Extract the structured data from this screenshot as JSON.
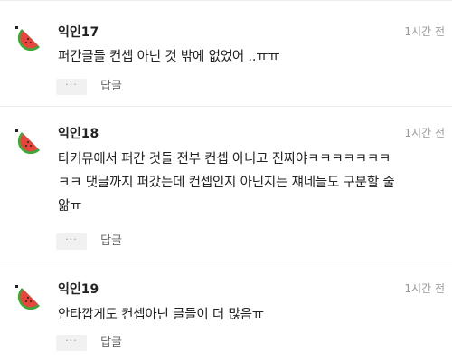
{
  "comments": [
    {
      "nickname": "익인17",
      "time": "1시간 전",
      "lines": [
        "퍼간글들 컨셉 아닌 것 밖에 없었어 ..ㅠㅠ"
      ],
      "more_label": "···",
      "reply_label": "답글"
    },
    {
      "nickname": "익인18",
      "time": "1시간 전",
      "lines": [
        "타커뮤에서 퍼간 것들 전부 컨셉 아니고 진짜야ㅋㅋㅋㅋㅋㅋㅋ",
        "ㅋㅋ 댓글까지 퍼갔는데 컨셉인지 아닌지는 쟤네들도 구분할 줄",
        "앎ㅠ"
      ],
      "more_label": "···",
      "reply_label": "답글"
    },
    {
      "nickname": "익인19",
      "time": "1시간 전",
      "lines": [
        "안타깝게도 컨셉아닌 글들이 더 많음ㅠ"
      ],
      "more_label": "···",
      "reply_label": "답글"
    }
  ],
  "avatar_icon": "watermelon-icon",
  "colors": {
    "watermelon_rind": "#3fa63a",
    "watermelon_flesh": "#e8453c",
    "seed": "#222222",
    "button_bg": "#f1f1f1"
  }
}
